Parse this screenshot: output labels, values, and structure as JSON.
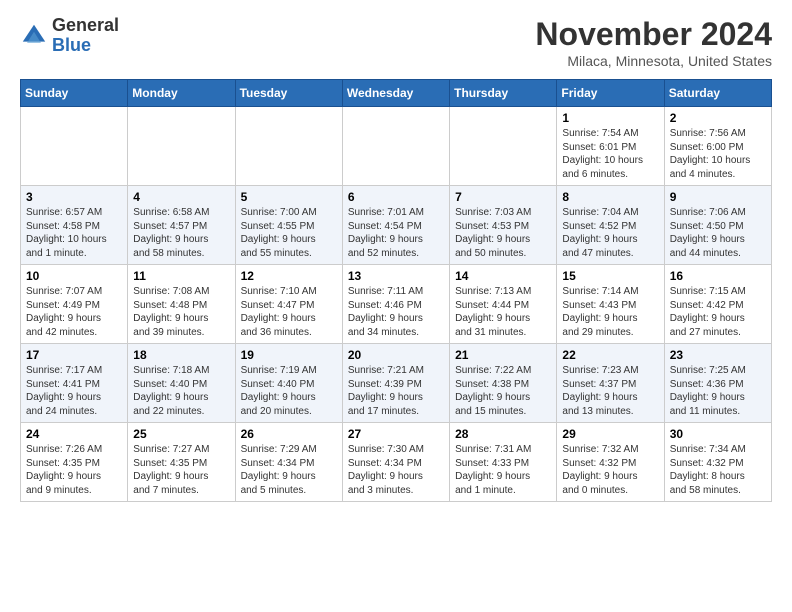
{
  "logo": {
    "general": "General",
    "blue": "Blue"
  },
  "header": {
    "month": "November 2024",
    "location": "Milaca, Minnesota, United States"
  },
  "weekdays": [
    "Sunday",
    "Monday",
    "Tuesday",
    "Wednesday",
    "Thursday",
    "Friday",
    "Saturday"
  ],
  "weeks": [
    [
      {
        "day": "",
        "info": ""
      },
      {
        "day": "",
        "info": ""
      },
      {
        "day": "",
        "info": ""
      },
      {
        "day": "",
        "info": ""
      },
      {
        "day": "",
        "info": ""
      },
      {
        "day": "1",
        "info": "Sunrise: 7:54 AM\nSunset: 6:01 PM\nDaylight: 10 hours\nand 6 minutes."
      },
      {
        "day": "2",
        "info": "Sunrise: 7:56 AM\nSunset: 6:00 PM\nDaylight: 10 hours\nand 4 minutes."
      }
    ],
    [
      {
        "day": "3",
        "info": "Sunrise: 6:57 AM\nSunset: 4:58 PM\nDaylight: 10 hours\nand 1 minute."
      },
      {
        "day": "4",
        "info": "Sunrise: 6:58 AM\nSunset: 4:57 PM\nDaylight: 9 hours\nand 58 minutes."
      },
      {
        "day": "5",
        "info": "Sunrise: 7:00 AM\nSunset: 4:55 PM\nDaylight: 9 hours\nand 55 minutes."
      },
      {
        "day": "6",
        "info": "Sunrise: 7:01 AM\nSunset: 4:54 PM\nDaylight: 9 hours\nand 52 minutes."
      },
      {
        "day": "7",
        "info": "Sunrise: 7:03 AM\nSunset: 4:53 PM\nDaylight: 9 hours\nand 50 minutes."
      },
      {
        "day": "8",
        "info": "Sunrise: 7:04 AM\nSunset: 4:52 PM\nDaylight: 9 hours\nand 47 minutes."
      },
      {
        "day": "9",
        "info": "Sunrise: 7:06 AM\nSunset: 4:50 PM\nDaylight: 9 hours\nand 44 minutes."
      }
    ],
    [
      {
        "day": "10",
        "info": "Sunrise: 7:07 AM\nSunset: 4:49 PM\nDaylight: 9 hours\nand 42 minutes."
      },
      {
        "day": "11",
        "info": "Sunrise: 7:08 AM\nSunset: 4:48 PM\nDaylight: 9 hours\nand 39 minutes."
      },
      {
        "day": "12",
        "info": "Sunrise: 7:10 AM\nSunset: 4:47 PM\nDaylight: 9 hours\nand 36 minutes."
      },
      {
        "day": "13",
        "info": "Sunrise: 7:11 AM\nSunset: 4:46 PM\nDaylight: 9 hours\nand 34 minutes."
      },
      {
        "day": "14",
        "info": "Sunrise: 7:13 AM\nSunset: 4:44 PM\nDaylight: 9 hours\nand 31 minutes."
      },
      {
        "day": "15",
        "info": "Sunrise: 7:14 AM\nSunset: 4:43 PM\nDaylight: 9 hours\nand 29 minutes."
      },
      {
        "day": "16",
        "info": "Sunrise: 7:15 AM\nSunset: 4:42 PM\nDaylight: 9 hours\nand 27 minutes."
      }
    ],
    [
      {
        "day": "17",
        "info": "Sunrise: 7:17 AM\nSunset: 4:41 PM\nDaylight: 9 hours\nand 24 minutes."
      },
      {
        "day": "18",
        "info": "Sunrise: 7:18 AM\nSunset: 4:40 PM\nDaylight: 9 hours\nand 22 minutes."
      },
      {
        "day": "19",
        "info": "Sunrise: 7:19 AM\nSunset: 4:40 PM\nDaylight: 9 hours\nand 20 minutes."
      },
      {
        "day": "20",
        "info": "Sunrise: 7:21 AM\nSunset: 4:39 PM\nDaylight: 9 hours\nand 17 minutes."
      },
      {
        "day": "21",
        "info": "Sunrise: 7:22 AM\nSunset: 4:38 PM\nDaylight: 9 hours\nand 15 minutes."
      },
      {
        "day": "22",
        "info": "Sunrise: 7:23 AM\nSunset: 4:37 PM\nDaylight: 9 hours\nand 13 minutes."
      },
      {
        "day": "23",
        "info": "Sunrise: 7:25 AM\nSunset: 4:36 PM\nDaylight: 9 hours\nand 11 minutes."
      }
    ],
    [
      {
        "day": "24",
        "info": "Sunrise: 7:26 AM\nSunset: 4:35 PM\nDaylight: 9 hours\nand 9 minutes."
      },
      {
        "day": "25",
        "info": "Sunrise: 7:27 AM\nSunset: 4:35 PM\nDaylight: 9 hours\nand 7 minutes."
      },
      {
        "day": "26",
        "info": "Sunrise: 7:29 AM\nSunset: 4:34 PM\nDaylight: 9 hours\nand 5 minutes."
      },
      {
        "day": "27",
        "info": "Sunrise: 7:30 AM\nSunset: 4:34 PM\nDaylight: 9 hours\nand 3 minutes."
      },
      {
        "day": "28",
        "info": "Sunrise: 7:31 AM\nSunset: 4:33 PM\nDaylight: 9 hours\nand 1 minute."
      },
      {
        "day": "29",
        "info": "Sunrise: 7:32 AM\nSunset: 4:32 PM\nDaylight: 9 hours\nand 0 minutes."
      },
      {
        "day": "30",
        "info": "Sunrise: 7:34 AM\nSunset: 4:32 PM\nDaylight: 8 hours\nand 58 minutes."
      }
    ]
  ]
}
